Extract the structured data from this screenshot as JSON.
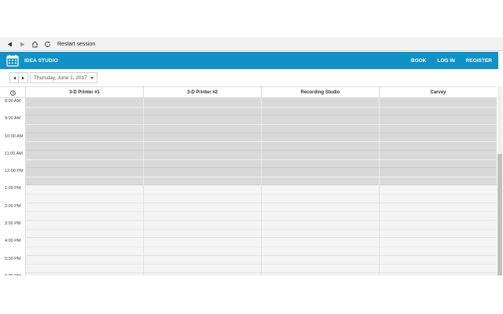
{
  "browser": {
    "restart_label": "Restart session",
    "back_icon": "back-arrow-icon",
    "forward_icon": "forward-arrow-icon",
    "home_icon": "home-icon",
    "reload_icon": "reload-icon"
  },
  "header": {
    "brand": "IDEA STUDIO",
    "logo_icon": "calendar-icon",
    "nav": [
      "BOOK",
      "LOG IN",
      "REGISTER"
    ],
    "color": "#1092c7"
  },
  "toolbar": {
    "date": "Thursday, June 1, 2017"
  },
  "scheduler": {
    "resources": [
      "3-D Printer #1",
      "3-D Printer #2",
      "Recording Studio",
      "Carvey"
    ],
    "times": [
      "8:00 AM",
      "9:00 AM",
      "10:00 AM",
      "11:00 AM",
      "12:00 PM",
      "1:00 PM",
      "2:00 PM",
      "3:00 PM",
      "4:00 PM",
      "5:00 PM",
      "6:00 PM"
    ],
    "unavailable_hours": [
      "8:00 AM",
      "9:00 AM",
      "10:00 AM",
      "11:00 AM",
      "12:00 PM"
    ],
    "closed_color": "#d9d9d9",
    "open_color": "#f4f4f4"
  }
}
